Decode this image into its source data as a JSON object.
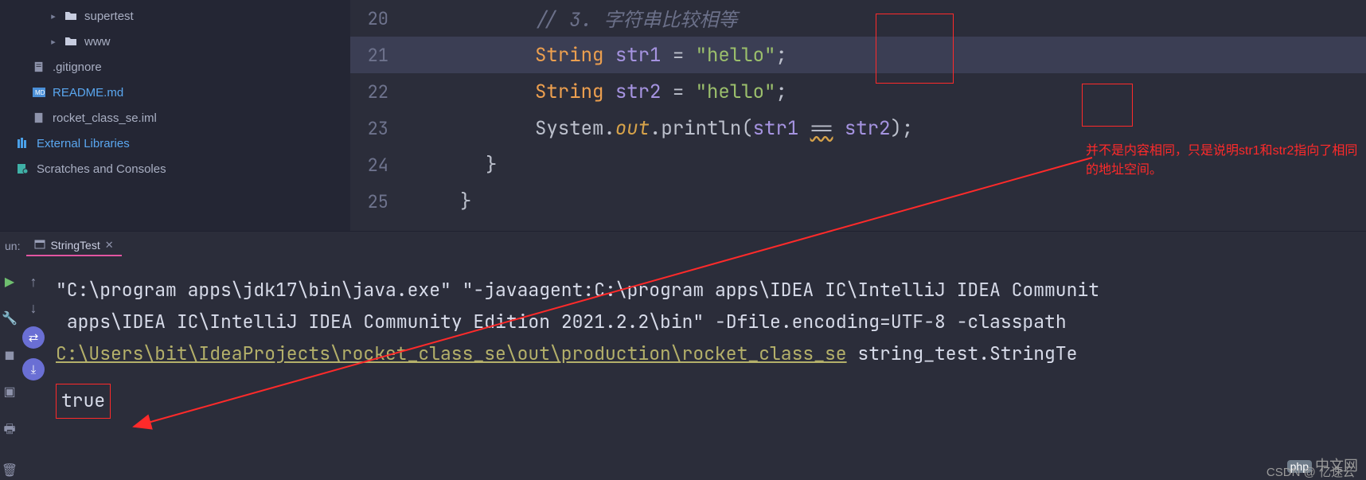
{
  "sidebar": {
    "items": [
      {
        "label": "supertest"
      },
      {
        "label": "www"
      },
      {
        "label": ".gitignore"
      },
      {
        "label": "README.md"
      },
      {
        "label": "rocket_class_se.iml"
      }
    ],
    "external_libraries": "External Libraries",
    "scratches": "Scratches and Consoles"
  },
  "editor": {
    "lines": [
      {
        "num": "20",
        "comment": "// 3. 字符串比较相等"
      },
      {
        "num": "21",
        "type_kw": "String",
        "var": "str1",
        "assign": " = ",
        "str": "\"hello\"",
        "end": ";"
      },
      {
        "num": "22",
        "type_kw": "String",
        "var": "str2",
        "assign": " = ",
        "str": "\"hello\"",
        "end": ";"
      },
      {
        "num": "23",
        "sys": "System",
        "dot1": ".",
        "out": "out",
        "dot2": ".",
        "println": "println",
        "open": "(",
        "a1": "str1",
        "sp": " ",
        "eq": "==",
        "sp2": " ",
        "a2": "str2",
        "close": ")",
        "end": ";"
      },
      {
        "num": "24",
        "brace": "}"
      },
      {
        "num": "25",
        "brace": "}"
      }
    ],
    "annotation_line1": "并不是内容相同，只是说明str1和str2指向了相同",
    "annotation_line2": "的地址空间。"
  },
  "run": {
    "label": "un:",
    "tab_name": "StringTest"
  },
  "console": {
    "line1_a": "\"C:\\program apps\\jdk17\\bin\\java.exe\" \"-javaagent:C:\\program apps\\IDEA IC\\IntelliJ IDEA Communit",
    "line2_a": "apps\\IDEA IC\\IntelliJ IDEA Community Edition 2021.2.2\\bin\" -Dfile.encoding=UTF-8 -classpath ",
    "line3_link": "C:\\Users\\bit\\IdeaProjects\\rocket_class_se\\out\\production\\rocket_class_se",
    "line3_b": " string_test.StringTe",
    "result": "true"
  },
  "watermark": {
    "php": "php",
    "text": "中文网",
    "sub": "CSDN @ 亿速云"
  }
}
